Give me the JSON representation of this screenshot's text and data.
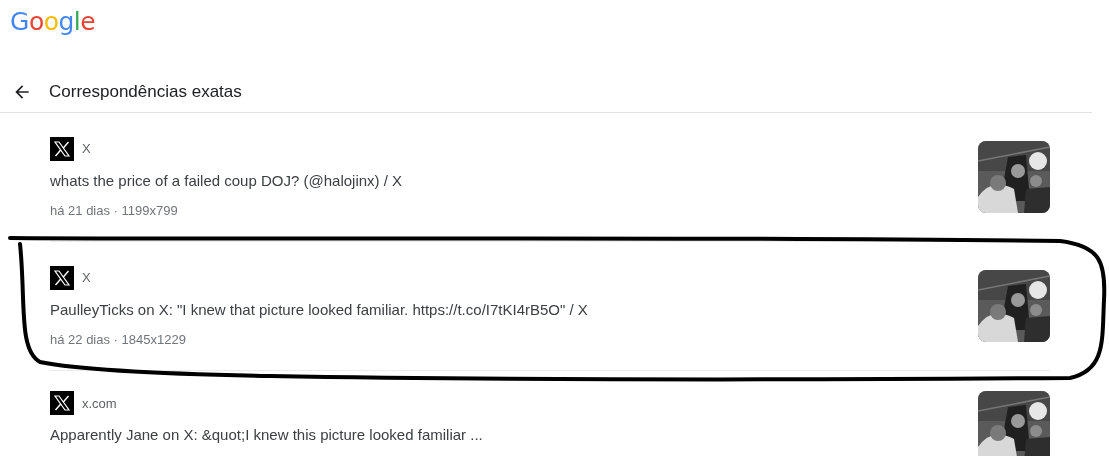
{
  "logo": "Google",
  "header": {
    "title": "Correspondências exatas"
  },
  "results": [
    {
      "source": "X",
      "title": "whats the price of a failed coup DOJ? (@halojinx) / X",
      "meta": "há 21 dias · 1199x799"
    },
    {
      "source": "X",
      "title": "PaulleyTicks on X: \"I knew that picture looked familiar. https://t.co/I7tKI4rB5O\" / X",
      "meta": "há 22 dias · 1845x1229"
    },
    {
      "source": "x.com",
      "title": "Apparently Jane on X: &quot;I knew this picture looked familiar ..."
    }
  ]
}
